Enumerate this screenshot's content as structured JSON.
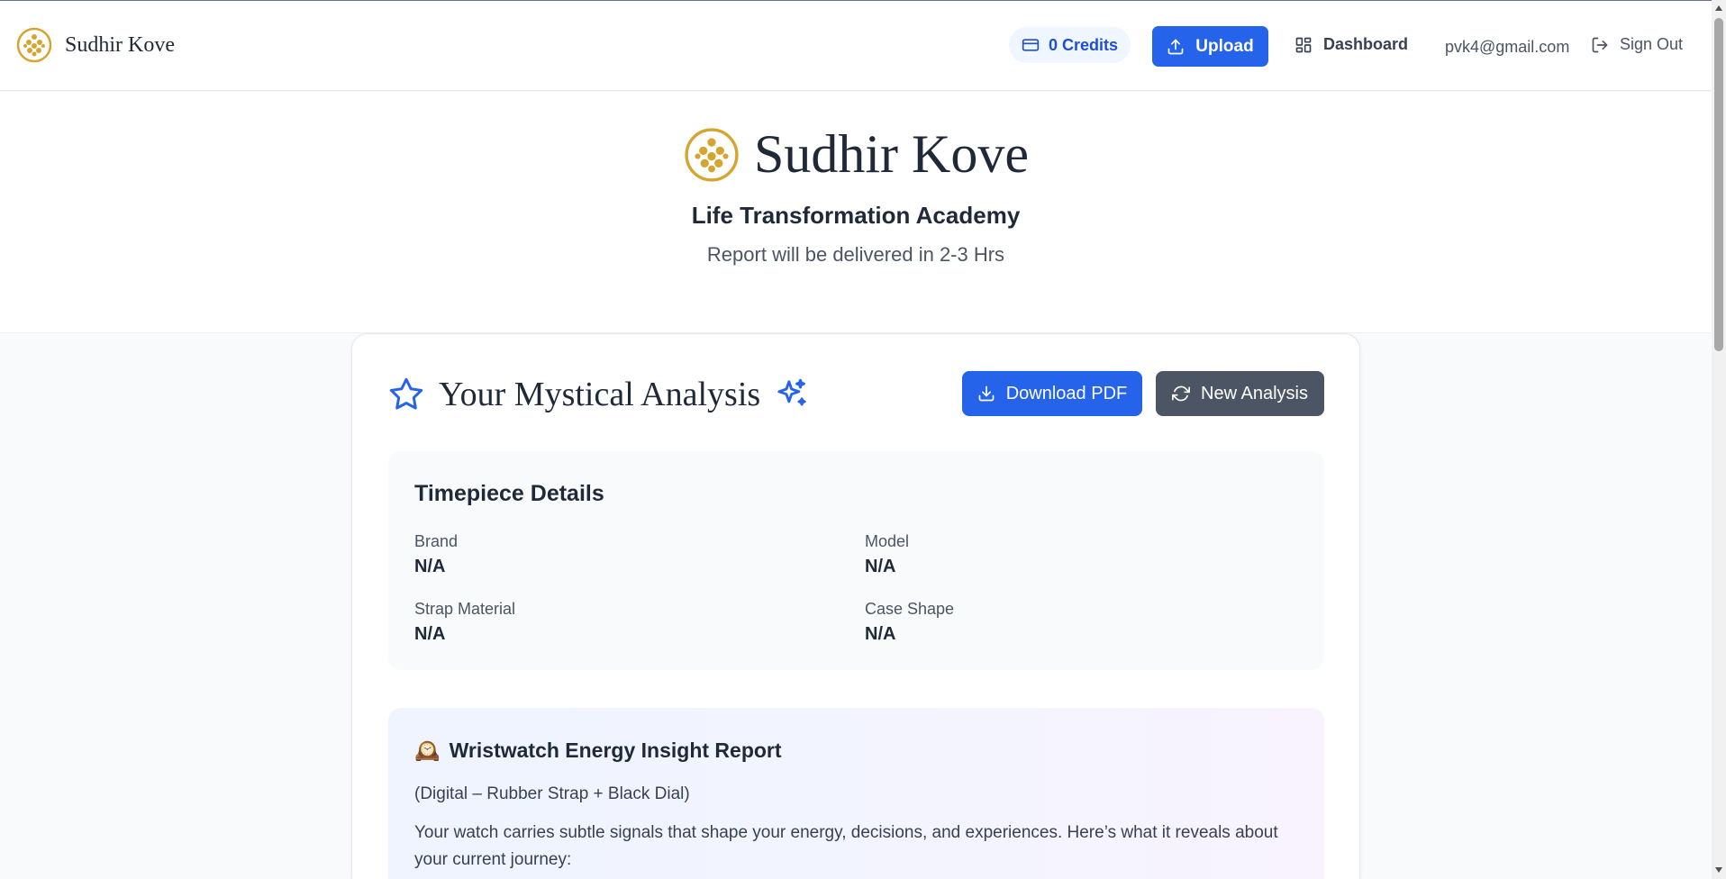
{
  "nav": {
    "brand": "Sudhir Kove",
    "credits": "0 Credits",
    "upload": "Upload",
    "dashboard": "Dashboard",
    "email": "pvk4@gmail.com",
    "signout": "Sign Out"
  },
  "hero": {
    "name": "Sudhir Kove",
    "subtitle": "Life Transformation Academy",
    "note": "Report will be delivered in 2-3 Hrs"
  },
  "analysis": {
    "title": "Your Mystical Analysis",
    "download": "Download PDF",
    "new": "New Analysis",
    "details": {
      "title": "Timepiece Details",
      "brand_label": "Brand",
      "brand_value": "N/A",
      "model_label": "Model",
      "model_value": "N/A",
      "strap_label": "Strap Material",
      "strap_value": "N/A",
      "case_label": "Case Shape",
      "case_value": "N/A"
    },
    "insight": {
      "icon": "🕰️",
      "title": "Wristwatch Energy Insight Report",
      "subtitle": "(Digital – Rubber Strap + Black Dial)",
      "body": "Your watch carries subtle signals that shape your energy, decisions, and experiences. Here’s what it reveals about your current journey:"
    }
  },
  "colors": {
    "primary": "#2563eb",
    "gold": "#d4a52f",
    "dark_button": "#4b5563"
  }
}
